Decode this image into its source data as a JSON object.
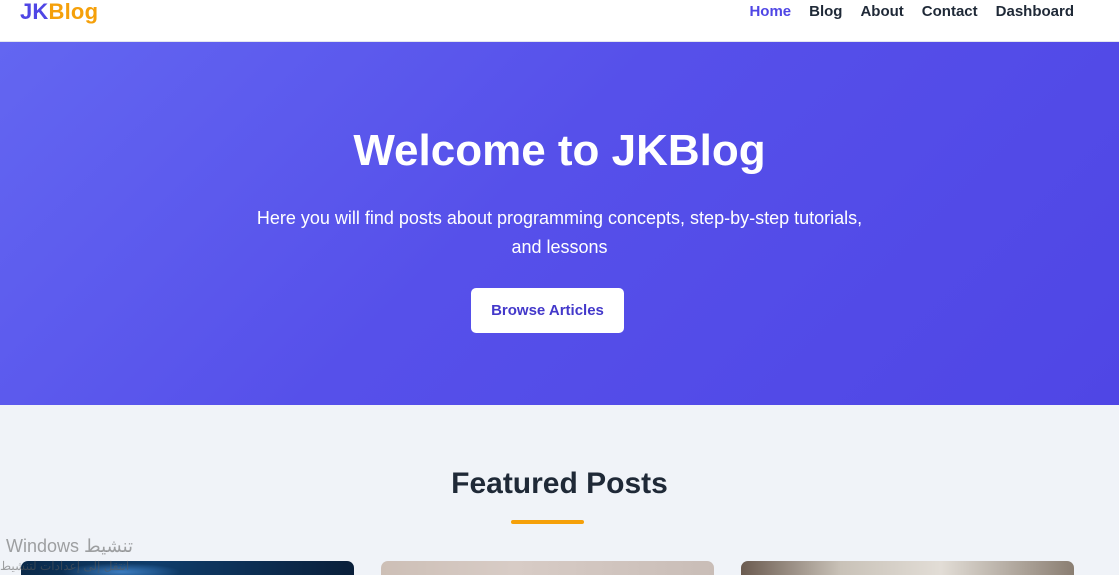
{
  "navbar": {
    "logo_part1": "JK",
    "logo_part2": "Blog",
    "links": [
      {
        "label": "Home",
        "active": true
      },
      {
        "label": "Blog",
        "active": false
      },
      {
        "label": "About",
        "active": false
      },
      {
        "label": "Contact",
        "active": false
      },
      {
        "label": "Dashboard",
        "active": false
      }
    ]
  },
  "hero": {
    "title": "Welcome to JKBlog",
    "subtitle": "Here you will find posts about programming concepts, step-by-step tutorials, and lessons",
    "cta_label": "Browse Articles"
  },
  "featured": {
    "heading": "Featured Posts",
    "card_count_visible": 3
  },
  "watermark": {
    "line1": "Windows تنشيط",
    "line2": "انتقل إلى إعدادات لتنشيط"
  },
  "colors": {
    "brand_primary": "#4f46e5",
    "brand_accent": "#f5a00a",
    "page_background": "#f0f3f8",
    "text_dark": "#1f2937"
  }
}
